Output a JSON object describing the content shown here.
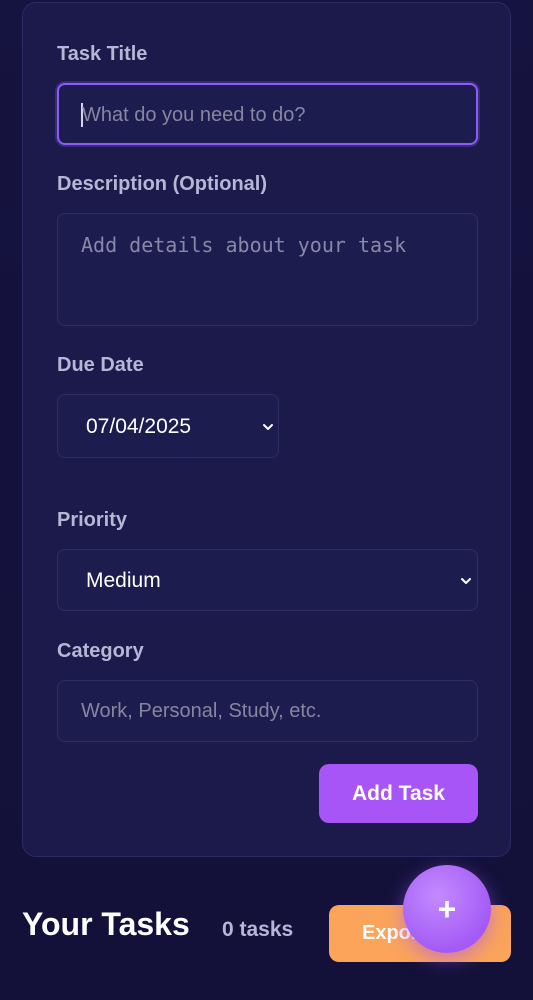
{
  "form": {
    "title_label": "Task Title",
    "title_placeholder": "What do you need to do?",
    "description_label": "Description (Optional)",
    "description_placeholder": "Add details about your task",
    "due_label": "Due Date",
    "due_value": "07/04/2025",
    "priority_label": "Priority",
    "priority_value": "Medium",
    "category_label": "Category",
    "category_placeholder": "Work, Personal, Study, etc.",
    "add_button": "Add Task"
  },
  "tasks": {
    "heading": "Your Tasks",
    "count": "0 tasks",
    "export_button": "Expor"
  },
  "fab": {
    "symbol": "+",
    "icon": "plus-icon"
  },
  "colors": {
    "background": "#14123d",
    "card": "#1b1a4b",
    "accent": "#a855f7",
    "export": "#fba45a"
  }
}
